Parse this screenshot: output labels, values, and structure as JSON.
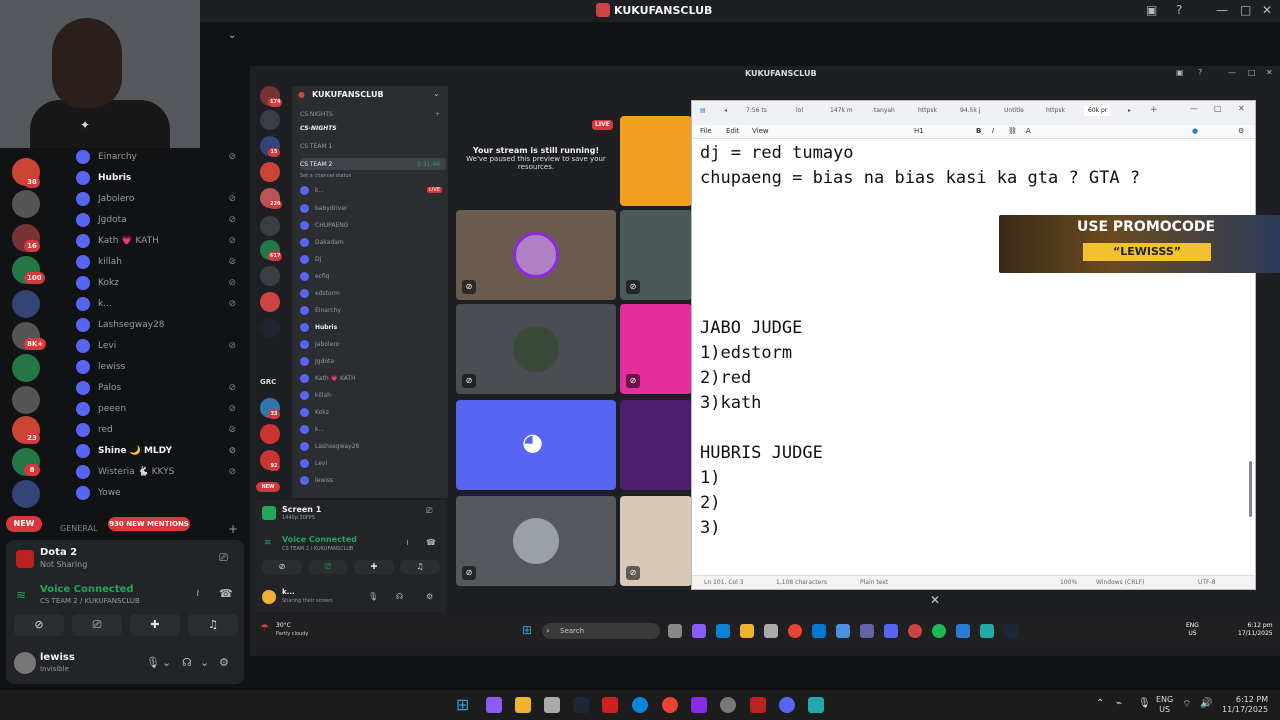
{
  "window": {
    "title": "KUKUFANSCLUB"
  },
  "inner_window": {
    "title": "KUKUFANSCLUB"
  },
  "server_badges": [
    "38",
    "",
    "16",
    "100",
    "",
    "8K+",
    "",
    "",
    "23",
    "8",
    ""
  ],
  "members": [
    {
      "name": "Einarchy",
      "bright": false
    },
    {
      "name": "Hubris",
      "bright": true
    },
    {
      "name": "Jabolero",
      "bright": false
    },
    {
      "name": "Jgdota",
      "bright": false
    },
    {
      "name": "Kath 💗 KATH",
      "bright": false
    },
    {
      "name": "killah",
      "bright": false
    },
    {
      "name": "Kokz",
      "bright": false
    },
    {
      "name": "k...",
      "bright": false
    },
    {
      "name": "Lashsegway28",
      "bright": false
    },
    {
      "name": "Levi",
      "bright": false
    },
    {
      "name": "lewiss",
      "bright": false
    },
    {
      "name": "Palos",
      "bright": false
    },
    {
      "name": "peeen",
      "bright": false
    },
    {
      "name": "red",
      "bright": false
    },
    {
      "name": "Shine 🌙 MLDY",
      "bright": true
    },
    {
      "name": "Wisteria 🐇 KKYS",
      "bright": false
    },
    {
      "name": "Yowe",
      "bright": false
    }
  ],
  "new_label": "NEW",
  "mentions_label": "930 NEW MENTIONS",
  "general_label": "GENERAL",
  "activity": {
    "game": "Dota 2",
    "status": "Not Sharing"
  },
  "voice": {
    "title": "Voice Connected",
    "channel": "CS TEAM 2 / KUKUFANSCLUB"
  },
  "user": {
    "name": "lewiss",
    "status": "Invisible"
  },
  "inner": {
    "server_name": "KUKUFANSCLUB",
    "server_badges": [
      "174",
      "",
      "",
      "15",
      "",
      "226",
      "",
      "617",
      "",
      "",
      "",
      "33",
      "",
      "92"
    ],
    "channels": [
      "CS NIGHTS",
      "CS-NIGHTS",
      "CS TEAM 1",
      "CS TEAM 2",
      "Set a channel status",
      "k...",
      "babydriver",
      "CHUPAENG",
      "Dakadam",
      "Dj",
      "ecfiq",
      "edstorm",
      "Einarchy",
      "Hubris",
      "Jabolero",
      "Jgdota",
      "Kath 💗 KATH",
      "killah",
      "Kokz",
      "k...",
      "Lashsegway28",
      "Levi",
      "lewiss"
    ],
    "team2_time": "3:31:46",
    "live": "LIVE",
    "new": "NEW",
    "grc": "GRC",
    "screen": {
      "title": "Screen 1",
      "sub": "1440p 30FPS"
    },
    "voice": {
      "title": "Voice Connected",
      "channel": "CS TEAM 2 / KUKUFANSCLUB"
    },
    "user": {
      "name": "k...",
      "status": "Sharing their screen"
    },
    "stream_msg": {
      "title": "Your stream is still running!",
      "body": "We've paused this preview to save your resources."
    },
    "weather": {
      "temp": "30°C",
      "desc": "Partly cloudy"
    },
    "search": "Search",
    "tray": {
      "lang1": "ENG",
      "lang2": "US",
      "time": "6:12 pm",
      "date": "17/11/2025"
    }
  },
  "notepad": {
    "tabs": [
      "7:56 ts",
      "lol",
      "147k m",
      "tanyah",
      "httpsk",
      "94.5k j",
      "Untitle",
      "httpsk",
      "60k pr"
    ],
    "menu": [
      "File",
      "Edit",
      "View"
    ],
    "heading_tool": "H1",
    "lines": [
      "dj = red tumayo",
      "chupaeng = bias na bias kasi ka gta ? GTA ?",
      "",
      "",
      "",
      "",
      "",
      "JABO JUDGE",
      "1)edstorm",
      "2)red",
      "3)kath",
      "",
      "HUBRIS JUDGE",
      "1)",
      "2)",
      "3)"
    ],
    "status": {
      "pos": "Ln 101, Col 3",
      "chars": "1,108 characters",
      "mode": "Plain text",
      "zoom": "100%",
      "eol": "Windows (CRLF)",
      "enc": "UTF-8"
    }
  },
  "promo": {
    "line1": "USE PROMOCODE",
    "line2": "“LEWISSS”"
  },
  "taskbar": {
    "lang1": "ENG",
    "lang2": "US",
    "time": "6:12 PM",
    "date": "11/17/2025"
  },
  "colors": {
    "discord_bg": "#1e1f22",
    "green": "#23a55a",
    "red": "#da373c",
    "blurple": "#5865f2"
  }
}
